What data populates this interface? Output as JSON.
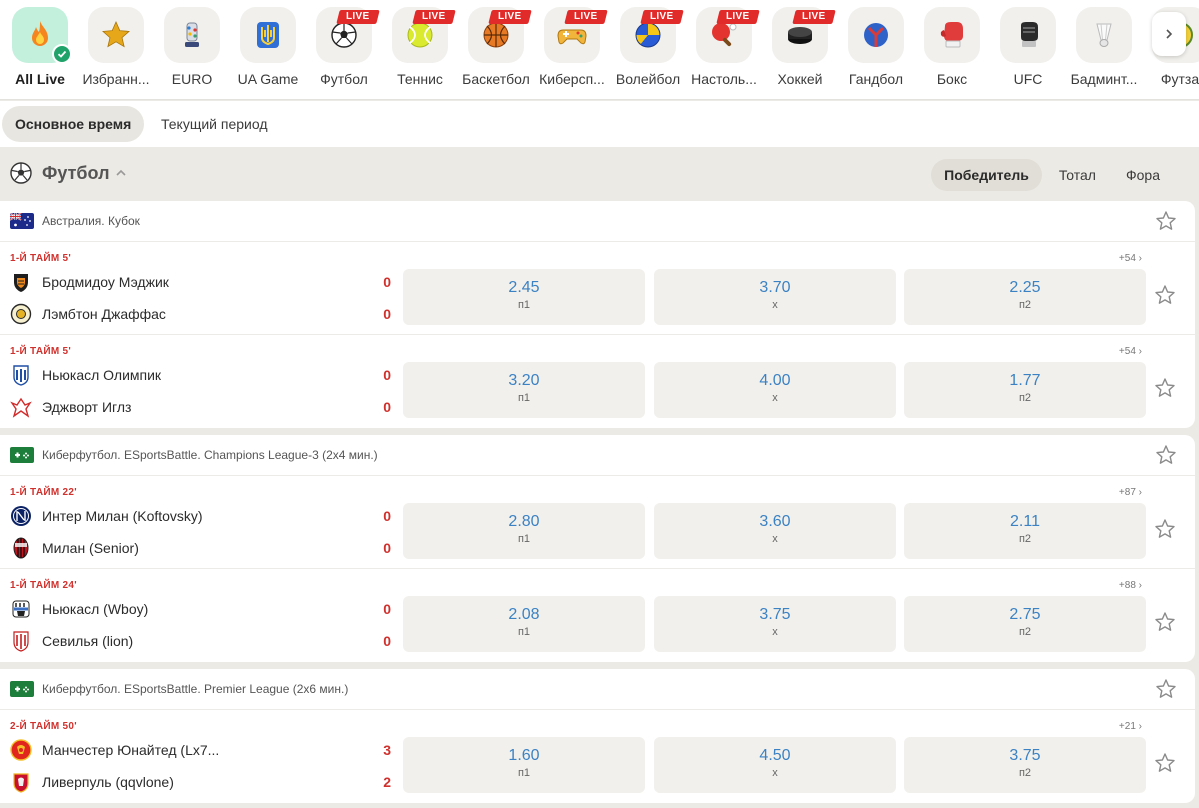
{
  "sports": [
    {
      "label": "All Live",
      "icon": "fire-icon",
      "active": true
    },
    {
      "label": "Избранн...",
      "icon": "star-icon"
    },
    {
      "label": "EURO",
      "icon": "euro-trophy-icon"
    },
    {
      "label": "UA Game",
      "icon": "ukraine-trident-icon"
    },
    {
      "label": "Футбол",
      "icon": "soccer-ball-icon",
      "live": "LIVE"
    },
    {
      "label": "Теннис",
      "icon": "tennis-ball-icon",
      "live": "LIVE"
    },
    {
      "label": "Баскетбол",
      "icon": "basketball-icon",
      "live": "LIVE"
    },
    {
      "label": "Киберсп...",
      "icon": "gamepad-icon",
      "live": "LIVE"
    },
    {
      "label": "Волейбол",
      "icon": "volleyball-icon",
      "live": "LIVE"
    },
    {
      "label": "Настоль...",
      "icon": "table-tennis-icon",
      "live": "LIVE"
    },
    {
      "label": "Хоккей",
      "icon": "hockey-puck-icon",
      "live": "LIVE"
    },
    {
      "label": "Гандбол",
      "icon": "handball-icon"
    },
    {
      "label": "Бокс",
      "icon": "boxing-glove-icon"
    },
    {
      "label": "UFC",
      "icon": "mma-glove-icon"
    },
    {
      "label": "Бадминт...",
      "icon": "shuttlecock-icon"
    },
    {
      "label": "Футза",
      "icon": "futsal-ball-icon"
    }
  ],
  "periods": {
    "main": "Основное время",
    "current": "Текущий период"
  },
  "section": {
    "title": "Футбол",
    "markets": [
      "Победитель",
      "Тотал",
      "Фора"
    ]
  },
  "leagues": [
    {
      "name": "Австралия. Кубок",
      "flag": "australia-flag-icon",
      "events": [
        {
          "status": "1-Й ТАЙМ 5'",
          "more": "+54",
          "teams": [
            {
              "name": "Бродмидоу Мэджик",
              "score": "0",
              "logo": "broadmeadow-logo-icon"
            },
            {
              "name": "Лэмбтон Джаффас",
              "score": "0",
              "logo": "lambton-logo-icon"
            }
          ],
          "odds": [
            {
              "value": "2.45",
              "label": "п1"
            },
            {
              "value": "3.70",
              "label": "х"
            },
            {
              "value": "2.25",
              "label": "п2"
            }
          ]
        },
        {
          "status": "1-Й ТАЙМ 5'",
          "more": "+54",
          "teams": [
            {
              "name": "Ньюкасл Олимпик",
              "score": "0",
              "logo": "newcastle-olympic-logo-icon"
            },
            {
              "name": "Эджворт Иглз",
              "score": "0",
              "logo": "edgeworth-logo-icon"
            }
          ],
          "odds": [
            {
              "value": "3.20",
              "label": "п1"
            },
            {
              "value": "4.00",
              "label": "х"
            },
            {
              "value": "1.77",
              "label": "п2"
            }
          ]
        }
      ]
    },
    {
      "name": "Киберфутбол. ESportsBattle. Champions League-3 (2x4 мин.)",
      "flag": "esports-flag-icon",
      "events": [
        {
          "status": "1-Й ТАЙМ 22'",
          "more": "+87",
          "teams": [
            {
              "name": "Интер Милан (Koftovsky)",
              "score": "0",
              "logo": "inter-logo-icon"
            },
            {
              "name": "Милан (Senior)",
              "score": "0",
              "logo": "milan-logo-icon"
            }
          ],
          "odds": [
            {
              "value": "2.80",
              "label": "п1"
            },
            {
              "value": "3.60",
              "label": "х"
            },
            {
              "value": "2.11",
              "label": "п2"
            }
          ]
        },
        {
          "status": "1-Й ТАЙМ 24'",
          "more": "+88",
          "teams": [
            {
              "name": "Ньюкасл (Wboy)",
              "score": "0",
              "logo": "newcastle-logo-icon"
            },
            {
              "name": "Севилья (lion)",
              "score": "0",
              "logo": "sevilla-logo-icon"
            }
          ],
          "odds": [
            {
              "value": "2.08",
              "label": "п1"
            },
            {
              "value": "3.75",
              "label": "х"
            },
            {
              "value": "2.75",
              "label": "п2"
            }
          ]
        }
      ]
    },
    {
      "name": "Киберфутбол. ESportsBattle. Premier League (2x6 мин.)",
      "flag": "esports-flag-icon",
      "events": [
        {
          "status": "2-Й ТАЙМ 50'",
          "more": "+21",
          "teams": [
            {
              "name": "Манчестер Юнайтед (Lx7...",
              "score": "3",
              "logo": "man-united-logo-icon"
            },
            {
              "name": "Ливерпуль (qqvlone)",
              "score": "2",
              "logo": "liverpool-logo-icon"
            }
          ],
          "odds": [
            {
              "value": "1.60",
              "label": "п1"
            },
            {
              "value": "4.50",
              "label": "х"
            },
            {
              "value": "3.75",
              "label": "п2"
            }
          ]
        }
      ]
    }
  ],
  "colors": {
    "accent": "#3b82c4",
    "live": "#e12a2a",
    "score": "#d0312d",
    "active_bg": "#c2f0dd",
    "check": "#1fa36a"
  }
}
